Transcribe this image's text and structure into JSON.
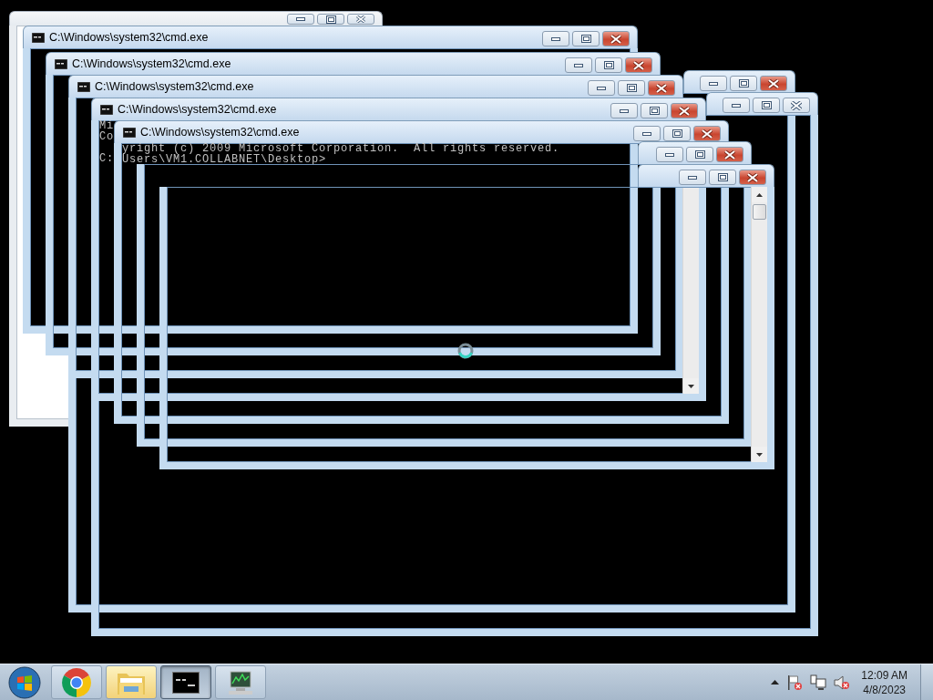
{
  "desktop": {
    "windows": [
      {
        "kind": "plain",
        "active": false
      },
      {
        "kind": "console",
        "active": true
      },
      {
        "kind": "console",
        "active": false
      },
      {
        "kind": "console",
        "active": true,
        "title": "C:\\Windows\\system32\\cmd.exe"
      },
      {
        "kind": "console",
        "active": true,
        "title": "C:\\Windows\\system32\\cmd.exe"
      },
      {
        "kind": "console",
        "active": true,
        "title": "C:\\Windows\\system32\\cmd.exe"
      },
      {
        "kind": "console",
        "active": true,
        "title": "C:\\Windows\\system32\\cmd.exe",
        "console": [
          [
            "Mi",
            "Co"
          ],
          [
            "C:"
          ]
        ]
      },
      {
        "kind": "console",
        "active": true,
        "title": "C:\\Windows\\system32\\cmd.exe",
        "console": [
          [
            "yright (c) 2009 Microsoft Corporation.  All rights reserved.",
            "Users\\VM1.COLLABNET\\Desktop>"
          ]
        ]
      },
      {
        "kind": "console",
        "active": true
      },
      {
        "kind": "console",
        "active": true
      }
    ]
  },
  "taskbar": {
    "items": [
      {
        "kind": "chrome",
        "highlighted": false,
        "selected": false
      },
      {
        "kind": "explorer",
        "highlighted": true,
        "selected": false
      },
      {
        "kind": "cmd",
        "highlighted": false,
        "selected": true
      },
      {
        "kind": "taskmgr",
        "highlighted": false,
        "selected": false
      }
    ],
    "clock": {
      "time": "12:09 AM",
      "date": "4/8/2023"
    }
  }
}
